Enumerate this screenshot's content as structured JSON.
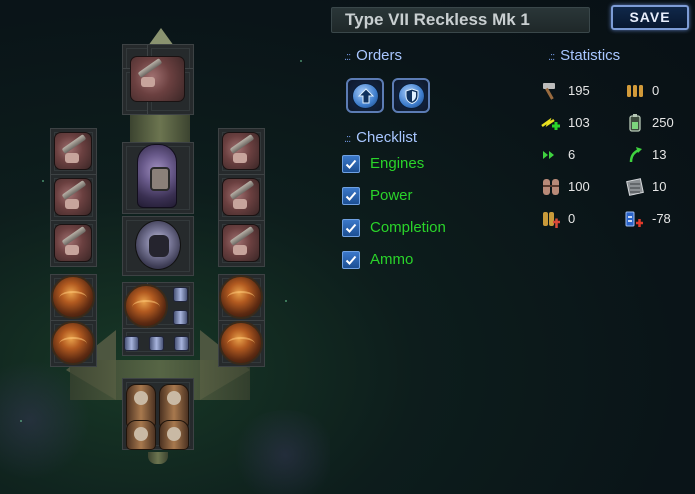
{
  "ship": {
    "name": "Type VII Reckless Mk 1"
  },
  "toolbar": {
    "save_label": "SAVE"
  },
  "orders": {
    "title": "Orders",
    "buttons": [
      {
        "icon": "arrow-up-icon"
      },
      {
        "icon": "shield-icon"
      }
    ]
  },
  "checklist": {
    "title": "Checklist",
    "items": [
      {
        "label": "Engines",
        "checked": true
      },
      {
        "label": "Power",
        "checked": true
      },
      {
        "label": "Completion",
        "checked": true
      },
      {
        "label": "Ammo",
        "checked": true
      }
    ]
  },
  "statistics": {
    "title": "Statistics",
    "items": [
      {
        "icon": "hammer-icon",
        "value": "195"
      },
      {
        "icon": "ammo-icon",
        "value": "0"
      },
      {
        "icon": "energy-icon",
        "value": "103"
      },
      {
        "icon": "battery-icon",
        "value": "250"
      },
      {
        "icon": "speed-icon",
        "value": "6"
      },
      {
        "icon": "turn-icon",
        "value": "13"
      },
      {
        "icon": "crew-icon",
        "value": "100"
      },
      {
        "icon": "armor-icon",
        "value": "10"
      },
      {
        "icon": "upkeep-icon",
        "value": "0"
      },
      {
        "icon": "power-balance-icon",
        "value": "-78"
      }
    ]
  },
  "colors": {
    "accent": "#a8c6ff",
    "check_text": "#2ad42a",
    "save_border": "#7d9cd6"
  }
}
